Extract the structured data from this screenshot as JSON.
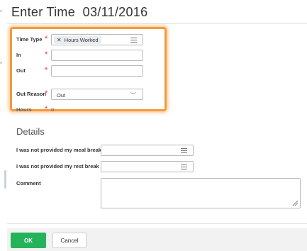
{
  "dialog": {
    "title": "Enter Time",
    "date": "03/11/2016"
  },
  "fields": {
    "time_type": {
      "label": "Time Type",
      "value": "Hours Worked",
      "required_mark": "*"
    },
    "in": {
      "label": "In",
      "value": "",
      "required_mark": "*"
    },
    "out": {
      "label": "Out",
      "value": "",
      "required_mark": "*"
    },
    "out_reason": {
      "label": "Out Reason",
      "value": "Out",
      "required_mark": "*"
    },
    "hours": {
      "label": "Hours",
      "value": "0",
      "required_mark": "*"
    }
  },
  "details": {
    "title": "Details",
    "meal_break": {
      "label": "I was not provided my meal break",
      "value": ""
    },
    "rest_break": {
      "label": "I was not provided my rest break",
      "value": ""
    },
    "comment": {
      "label": "Comment",
      "value": ""
    }
  },
  "footer": {
    "ok_label": "OK",
    "cancel_label": "Cancel"
  },
  "colors": {
    "highlight": "#f39a3c",
    "ok_button": "#25b35a",
    "required": "#ee3333"
  },
  "icons": {
    "remove_chip": "close-icon",
    "prompt_list": "list-icon",
    "dropdown": "chevron-down-icon",
    "resize": "resize-handle-icon"
  }
}
